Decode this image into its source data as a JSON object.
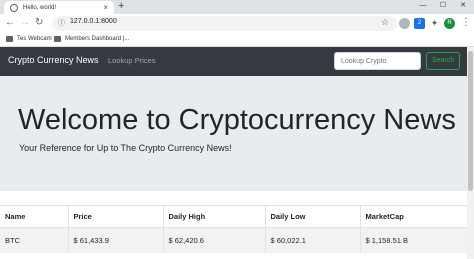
{
  "browser": {
    "tab_title": "Hello, world!",
    "tab_close": "×",
    "new_tab": "+",
    "window_controls": [
      "—",
      "☐",
      "✕"
    ],
    "url": "127.0.0.1:8000",
    "bookmarks": [
      "Tes Webcam",
      "Members Dashboard |..."
    ],
    "profile_initial": "R",
    "extension_badge": "2"
  },
  "navbar": {
    "brand": "Crypto Currency News",
    "link": "Lookup Prices",
    "search_placeholder": "Lookup Crypto",
    "search_button": "Search"
  },
  "jumbotron": {
    "heading": "Welcome to Cryptocurrency News",
    "subheading": "Your Reference for Up to The Crypto Currency News!"
  },
  "table": {
    "headers": [
      "Name",
      "Price",
      "Daily High",
      "Daily Low",
      "MarketCap"
    ],
    "rows": [
      [
        "BTC",
        "$ 61,433.9",
        "$ 62,420.6",
        "$ 60,022.1",
        "$ 1,158.51 B"
      ]
    ]
  },
  "colors": {
    "navbar_bg": "#343a40",
    "jumbotron_bg": "#e9ecef",
    "search_button": "#28a745"
  }
}
